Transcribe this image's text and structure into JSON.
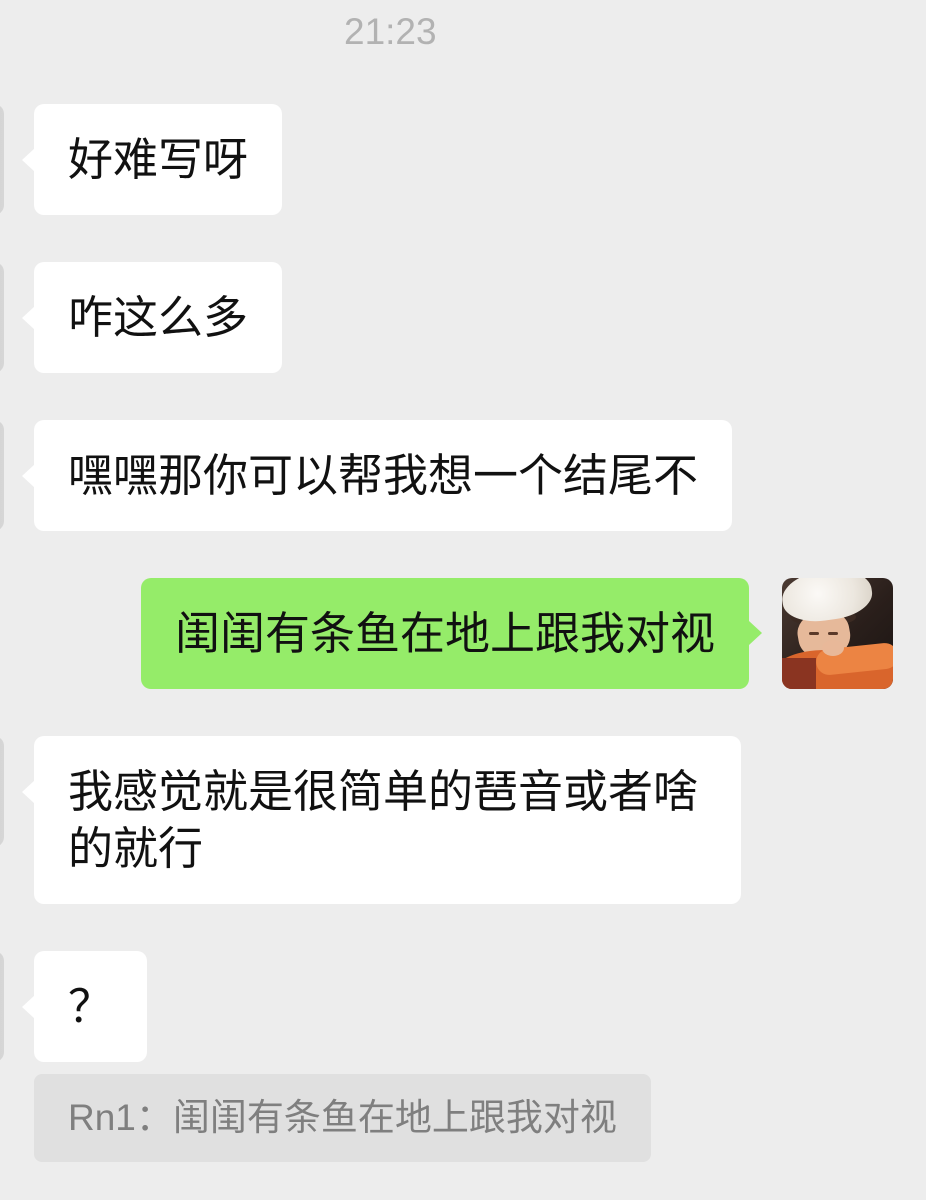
{
  "chat": {
    "timestamp": "21:23",
    "messages": [
      {
        "text": "好难写呀"
      },
      {
        "text": "咋这么多"
      },
      {
        "text": "嘿嘿那你可以帮我想一个结尾不"
      },
      {
        "text": "闺闺有条鱼在地上跟我对视"
      },
      {
        "text": "我感觉就是很简单的琶音或者啥的就行"
      },
      {
        "text": "？"
      }
    ],
    "quote": {
      "author": "Rn1",
      "separator": "：",
      "text": "闺闺有条鱼在地上跟我对视"
    }
  },
  "avatars": {
    "self": "profile-photo",
    "peer": "profile-photo-cropped"
  },
  "colors": {
    "background": "#ededed",
    "peer_bubble": "#ffffff",
    "self_bubble": "#95ec69",
    "timestamp": "#b2b2b2",
    "quote_background": "#e0e0e0",
    "quote_text": "#7f7f7f"
  }
}
